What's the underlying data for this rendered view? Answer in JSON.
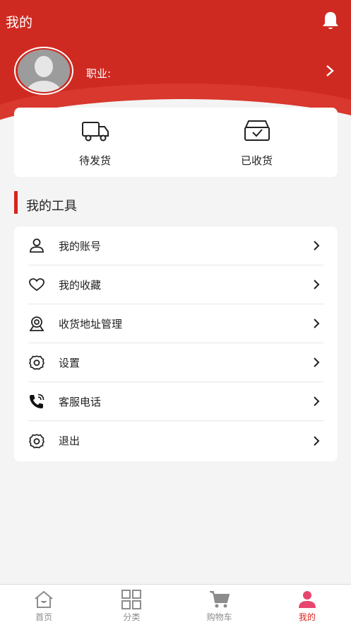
{
  "header": {
    "title": "我的",
    "bell_icon": "bell-icon"
  },
  "profile": {
    "avatar_icon": "default-avatar",
    "job_label": "职业:"
  },
  "orders": [
    {
      "label": "待发货",
      "icon": "truck-icon"
    },
    {
      "label": "已收货",
      "icon": "inbox-check-icon"
    }
  ],
  "tools": {
    "title": "我的工具",
    "items": [
      {
        "label": "我的账号",
        "icon": "user-icon"
      },
      {
        "label": "我的收藏",
        "icon": "heart-icon"
      },
      {
        "label": "收货地址管理",
        "icon": "location-icon"
      },
      {
        "label": "设置",
        "icon": "gear-icon"
      },
      {
        "label": "客服电话",
        "icon": "phone-icon"
      },
      {
        "label": "退出",
        "icon": "gear-icon"
      }
    ]
  },
  "tabbar": {
    "items": [
      {
        "label": "首页",
        "icon": "home-icon",
        "active": false
      },
      {
        "label": "分类",
        "icon": "grid-icon",
        "active": false
      },
      {
        "label": "购物车",
        "icon": "cart-icon",
        "active": false
      },
      {
        "label": "我的",
        "icon": "person-icon",
        "active": true
      }
    ]
  },
  "colors": {
    "brand_red": "#cf2a21",
    "accent_red": "#d8231c"
  }
}
